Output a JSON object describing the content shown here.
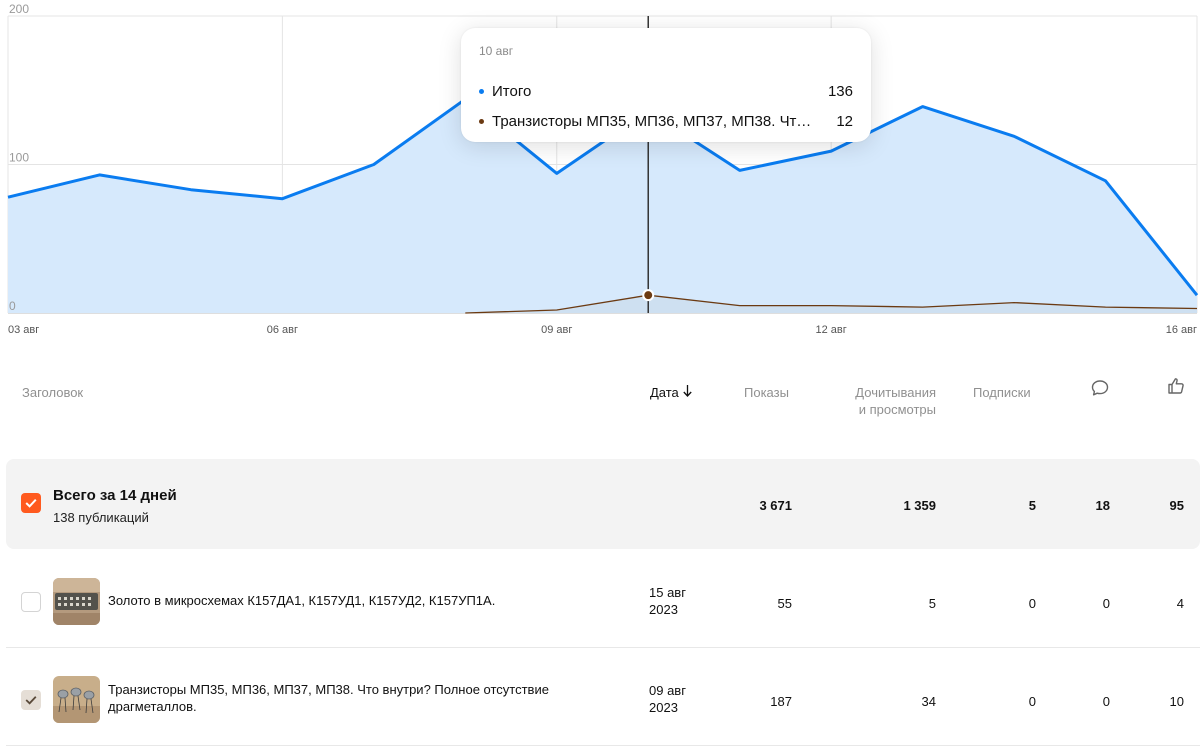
{
  "chart_data": {
    "type": "area",
    "x": [
      "03 авг",
      "04 авг",
      "05 авг",
      "06 авг",
      "07 авг",
      "08 авг",
      "09 авг",
      "10 авг",
      "11 авг",
      "12 авг",
      "13 авг",
      "14 авг",
      "15 авг",
      "16 авг"
    ],
    "x_tick_labels": [
      "03 авг",
      "06 авг",
      "09 авг",
      "12 авг",
      "16 авг"
    ],
    "y_tick_labels": [
      "0",
      "100",
      "200"
    ],
    "ylim": [
      0,
      200
    ],
    "grid": true,
    "series": [
      {
        "name": "Итого",
        "color": "#0a7cf0",
        "fill": "#d6e9fc",
        "values": [
          78,
          93,
          83,
          77,
          100,
          144,
          94,
          136,
          96,
          109,
          139,
          119,
          89,
          12
        ]
      },
      {
        "name": "Транзисторы МП35, МП36, МП37, МП38. Что внутри? Полное отсутствие драгметаллов.",
        "color": "#6b3a12",
        "values": [
          null,
          null,
          null,
          null,
          null,
          0,
          2,
          12,
          5,
          5,
          4,
          7,
          4,
          3
        ]
      }
    ],
    "hover_index": 7
  },
  "tooltip": {
    "date": "10 авг",
    "rows": [
      {
        "label": "Итого",
        "value": "136",
        "color": "#0a7cf0"
      },
      {
        "label": "Транзисторы МП35, МП36, МП37, МП38. Что внутри? Полное отсутствие драгметаллов.",
        "value": "12",
        "color": "#6b3a12"
      }
    ]
  },
  "table": {
    "headers": {
      "title": "Заголовок",
      "date": "Дата",
      "date_sort_icon": "arrow-down-icon",
      "views": "Показы",
      "reads_line1": "Дочитывания",
      "reads_line2": "и просмотры",
      "subs": "Подписки",
      "comments_icon": "comment-icon",
      "likes_icon": "like-icon"
    },
    "total": {
      "title": "Всего за 14 дней",
      "subtitle": "138 публикаций",
      "views": "3 671",
      "reads": "1 359",
      "subs": "5",
      "comments": "18",
      "likes": "95",
      "checked": true
    },
    "rows": [
      {
        "title": "Золото в микросхемах К157ДА1, К157УД1, К157УД2, К157УП1А.",
        "date_line1": "15 авг",
        "date_line2": "2023",
        "views": "55",
        "reads": "5",
        "subs": "0",
        "comments": "0",
        "likes": "4",
        "checked": false
      },
      {
        "title": "Транзисторы МП35, МП36, МП37, МП38. Что внутри? Полное отсутствие драгметаллов.",
        "date_line1": "09 авг",
        "date_line2": "2023",
        "views": "187",
        "reads": "34",
        "subs": "0",
        "comments": "0",
        "likes": "10",
        "checked": true
      }
    ]
  },
  "colors": {
    "accent": "#ff5a1f",
    "series_total": "#0a7cf0",
    "series_article": "#6b3a12",
    "area_fill": "#d6e9fc"
  }
}
